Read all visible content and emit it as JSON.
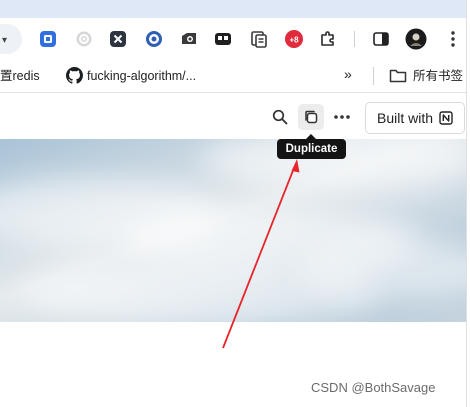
{
  "bookmarks": {
    "item_redis": "置redis",
    "item_github": "fucking-algorithm/...",
    "overflow": "»",
    "all_bookmarks": "所有书签"
  },
  "extensions": {
    "badge_text": "+8"
  },
  "appbar": {
    "built_with_label": "Built with"
  },
  "tooltip": {
    "label": "Duplicate"
  },
  "watermark": {
    "text": "CSDN @BothSavage"
  },
  "colors": {
    "annotation_arrow": "#e8262b",
    "tooltip_bg": "#141414",
    "top_strip": "#dfe8f7"
  }
}
